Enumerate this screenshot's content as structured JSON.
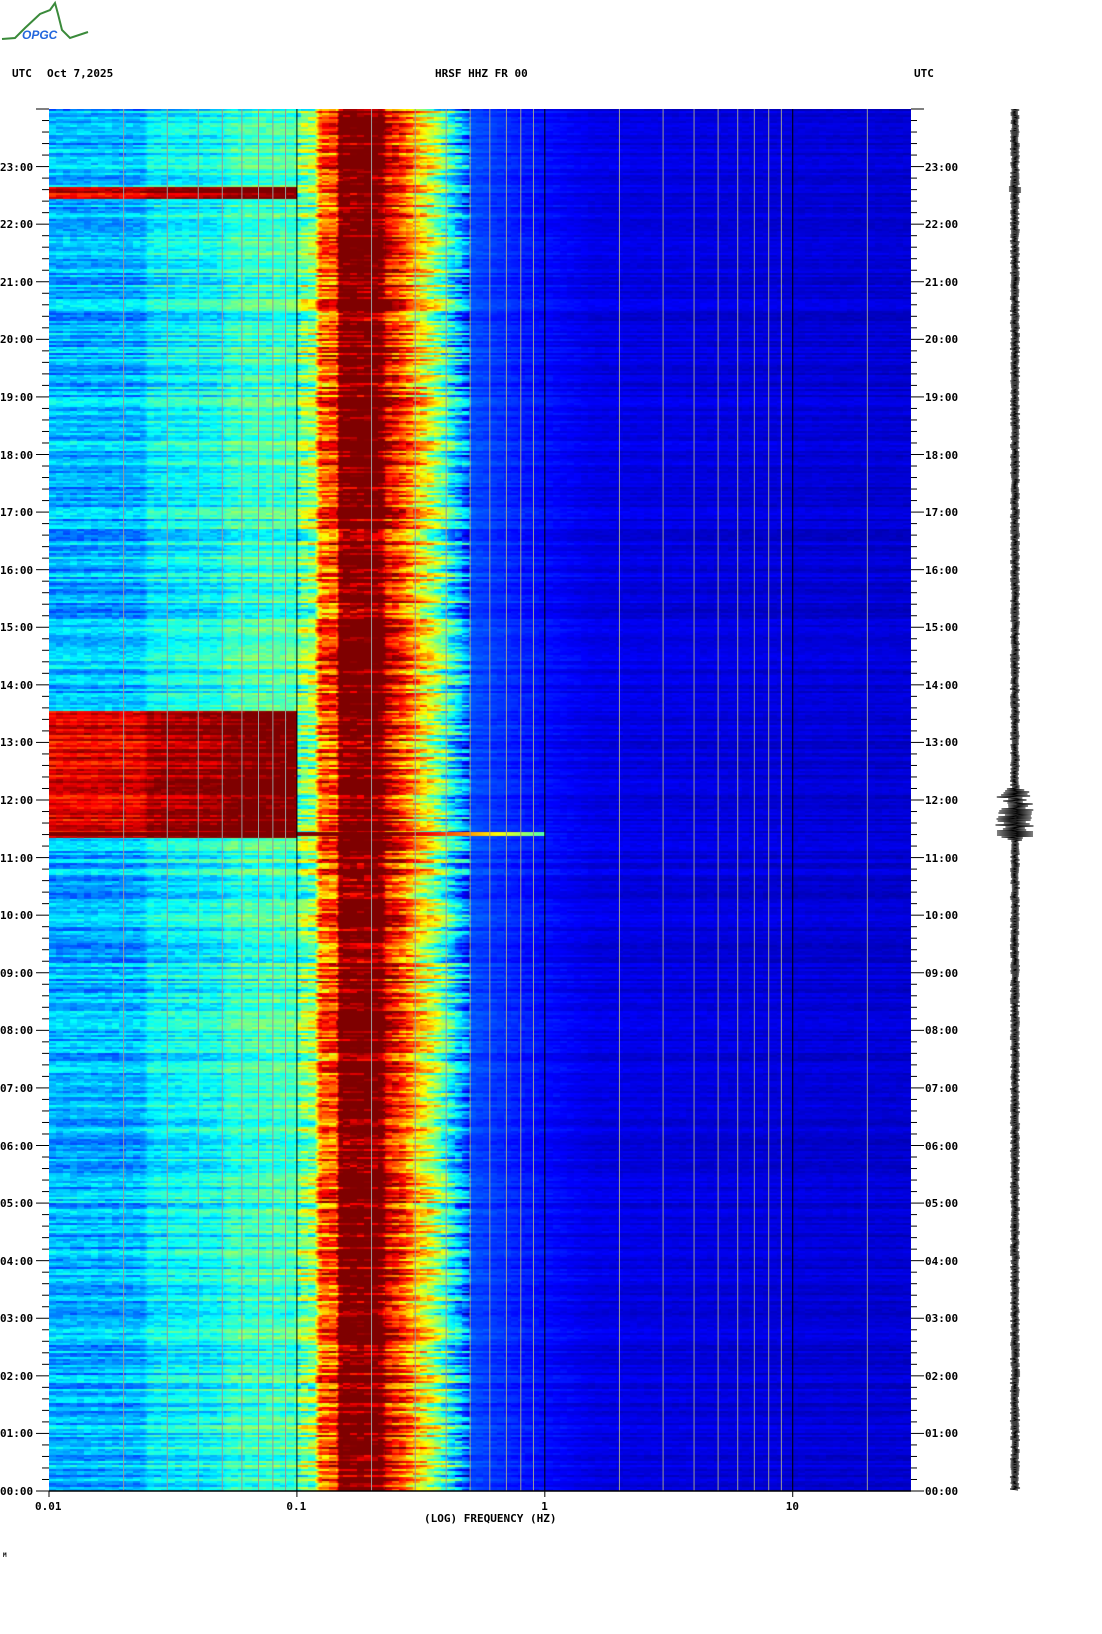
{
  "header": {
    "left_tz": "UTC",
    "date": "Oct 7,2025",
    "station": "HRSF HHZ FR 00",
    "right_tz": "UTC"
  },
  "logo": {
    "text": "OPGC"
  },
  "footer": {
    "mark": "M"
  },
  "colors": {
    "navy": "#00008c",
    "blue": "#0060ff",
    "cyan": "#00ffff",
    "yellow": "#ffff00",
    "red": "#ff0000",
    "darkred": "#800000"
  },
  "chart_data": {
    "type": "heatmap",
    "title": "HRSF HHZ FR 00",
    "xlabel": "(LOG) FREQUENCY (HZ)",
    "xscale": "log",
    "xlim": [
      0.01,
      30
    ],
    "xticks": [
      {
        "v": 0.01,
        "label": "0.01"
      },
      {
        "v": 0.1,
        "label": "0.1"
      },
      {
        "v": 1,
        "label": "1"
      },
      {
        "v": 10,
        "label": "10"
      }
    ],
    "ylabel": "UTC",
    "ylim_hours": [
      0,
      24
    ],
    "yticks": [
      "00:00",
      "01:00",
      "02:00",
      "03:00",
      "04:00",
      "05:00",
      "06:00",
      "07:00",
      "08:00",
      "09:00",
      "10:00",
      "11:00",
      "12:00",
      "13:00",
      "14:00",
      "15:00",
      "16:00",
      "17:00",
      "18:00",
      "19:00",
      "20:00",
      "21:00",
      "22:00",
      "23:00"
    ],
    "grid_minor_freqs": [
      0.02,
      0.03,
      0.04,
      0.05,
      0.06,
      0.07,
      0.08,
      0.09,
      0.2,
      0.3,
      0.4,
      0.5,
      0.6,
      0.7,
      0.8,
      0.9,
      2,
      3,
      4,
      5,
      6,
      7,
      8,
      9,
      20
    ],
    "colormap": "jet",
    "microseism_peak_hz": [
      0.14,
      0.22
    ],
    "events": [
      {
        "start_h": 11.35,
        "end_h": 13.55,
        "max_freq_hz": 0.1,
        "note": "long-period energy"
      },
      {
        "start_h": 11.38,
        "end_h": 11.45,
        "max_freq_hz": 1.0,
        "note": "earthquake arrival"
      },
      {
        "start_h": 22.45,
        "end_h": 22.65,
        "max_freq_hz": 0.1,
        "note": "long-period energy"
      }
    ]
  }
}
